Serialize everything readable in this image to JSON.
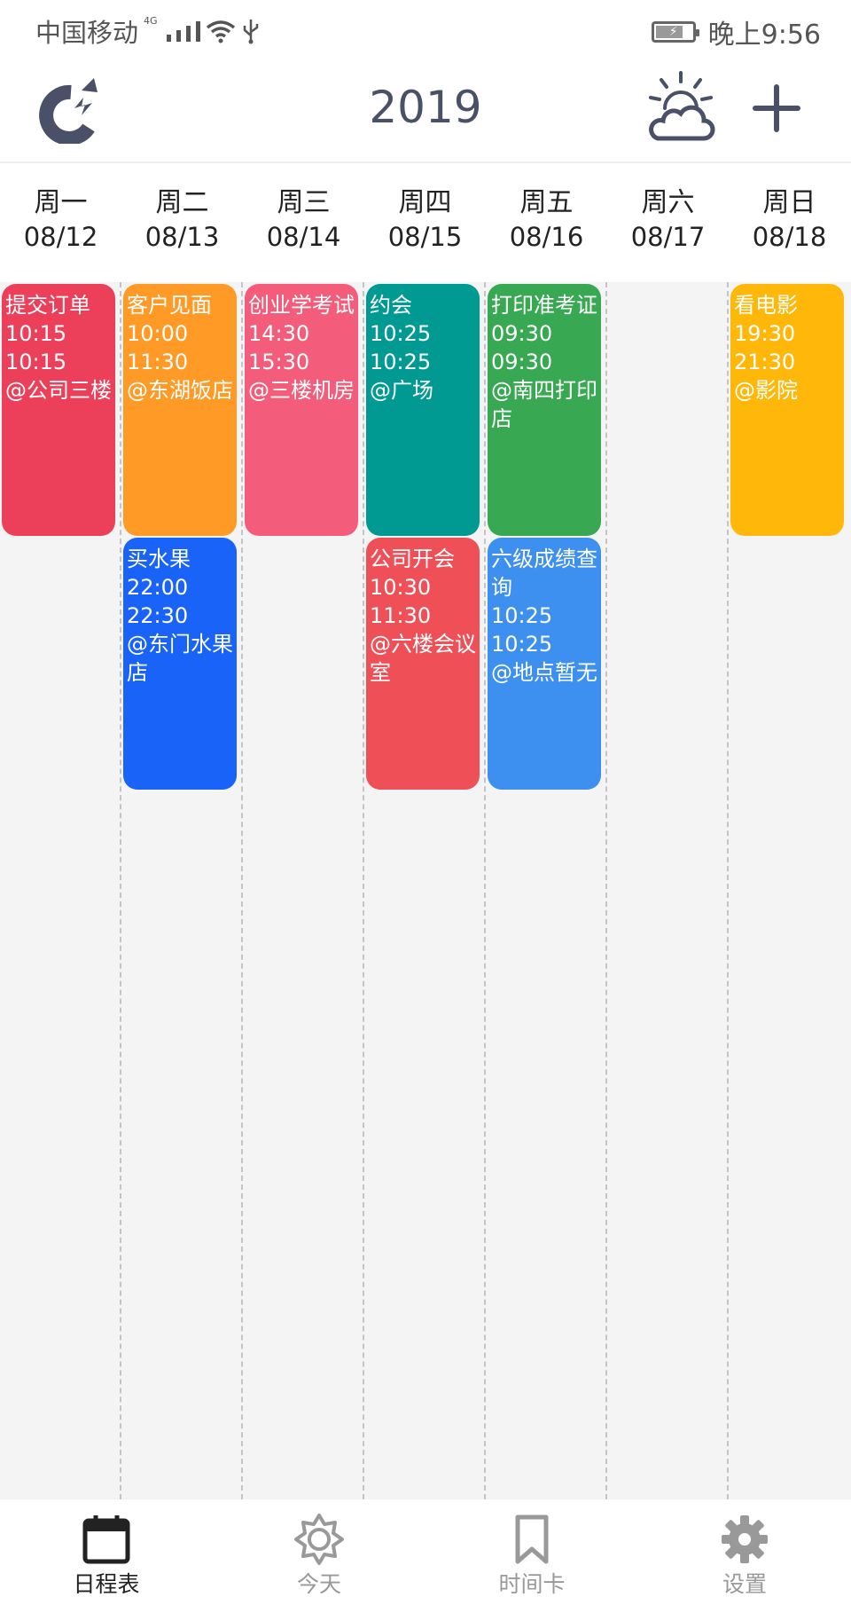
{
  "status": {
    "carrier": "中国移动",
    "network": "4G",
    "time": "晚上9:56"
  },
  "header": {
    "title": "2019"
  },
  "days": [
    {
      "name": "周一",
      "date": "08/12"
    },
    {
      "name": "周二",
      "date": "08/13"
    },
    {
      "name": "周三",
      "date": "08/14"
    },
    {
      "name": "周四",
      "date": "08/15"
    },
    {
      "name": "周五",
      "date": "08/16"
    },
    {
      "name": "周六",
      "date": "08/17"
    },
    {
      "name": "周日",
      "date": "08/18"
    }
  ],
  "events": [
    {
      "day": 0,
      "slot": 0,
      "title": "提交订单",
      "start": "10:15",
      "end": "10:15",
      "location": "@公司三楼",
      "color": "#ec405a"
    },
    {
      "day": 1,
      "slot": 0,
      "title": "客户见面",
      "start": "10:00",
      "end": "11:30",
      "location": "@东湖饭店",
      "color": "#ff9a26"
    },
    {
      "day": 1,
      "slot": 1,
      "title": "买水果",
      "start": "22:00",
      "end": "22:30",
      "location": "@东门水果店",
      "color": "#1a63f8"
    },
    {
      "day": 2,
      "slot": 0,
      "title": "创业学考试",
      "start": "14:30",
      "end": "15:30",
      "location": "@三楼机房",
      "color": "#f35c7a"
    },
    {
      "day": 3,
      "slot": 0,
      "title": "约会",
      "start": "10:25",
      "end": "10:25",
      "location": "@广场",
      "color": "#009a92"
    },
    {
      "day": 3,
      "slot": 1,
      "title": "公司开会",
      "start": "10:30",
      "end": "11:30",
      "location": "@六楼会议室",
      "color": "#ef4f57"
    },
    {
      "day": 4,
      "slot": 0,
      "title": "打印准考证",
      "start": "09:30",
      "end": "09:30",
      "location": "@南四打印店",
      "color": "#38a853"
    },
    {
      "day": 4,
      "slot": 1,
      "title": "六级成绩查询",
      "start": "10:25",
      "end": "10:25",
      "location": "@地点暂无",
      "color": "#3d8ff0"
    },
    {
      "day": 6,
      "slot": 0,
      "title": "看电影",
      "start": "19:30",
      "end": "21:30",
      "location": "@影院",
      "color": "#ffb80a"
    }
  ],
  "nav": [
    {
      "label": "日程表",
      "icon": "calendar-icon",
      "active": true
    },
    {
      "label": "今天",
      "icon": "sun-icon",
      "active": false
    },
    {
      "label": "时间卡",
      "icon": "bookmark-icon",
      "active": false
    },
    {
      "label": "设置",
      "icon": "gear-icon",
      "active": false
    }
  ]
}
